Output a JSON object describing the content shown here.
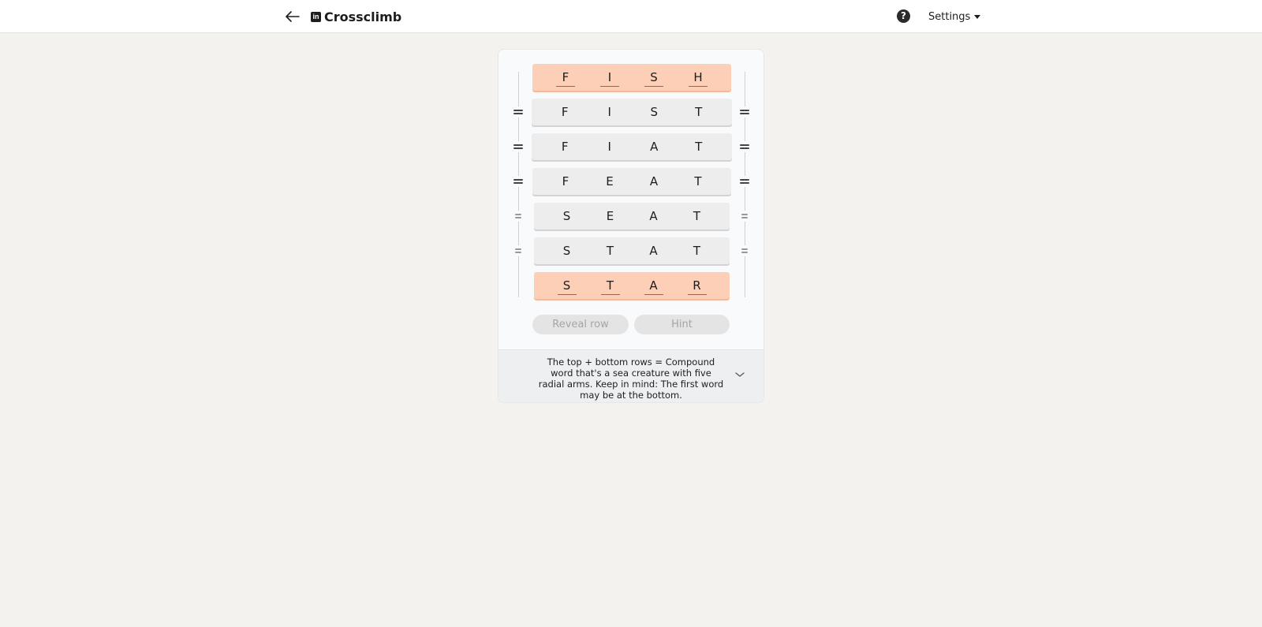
{
  "header": {
    "brand_logo": "in",
    "title": "Crossclimb",
    "help_glyph": "?",
    "settings_label": "Settings"
  },
  "puzzle": {
    "rows": [
      {
        "letters": [
          "F",
          "I",
          "S",
          "H"
        ],
        "state": "target"
      },
      {
        "letters": [
          "F",
          "I",
          "S",
          "T"
        ],
        "state": "middle"
      },
      {
        "letters": [
          "F",
          "I",
          "A",
          "T"
        ],
        "state": "middle"
      },
      {
        "letters": [
          "F",
          "E",
          "A",
          "T"
        ],
        "state": "middle"
      },
      {
        "letters": [
          "S",
          "E",
          "A",
          "T"
        ],
        "state": "middle"
      },
      {
        "letters": [
          "S",
          "T",
          "A",
          "T"
        ],
        "state": "middle"
      },
      {
        "letters": [
          "S",
          "T",
          "A",
          "R"
        ],
        "state": "target"
      }
    ],
    "target_color": "#fdcfb6",
    "middle_color": "#ededed"
  },
  "actions": {
    "reveal_label": "Reveal row",
    "hint_label": "Hint"
  },
  "clue": {
    "text": "The top + bottom rows = Compound word that's a sea creature with five radial arms. Keep in mind: The first word may be at the bottom."
  }
}
